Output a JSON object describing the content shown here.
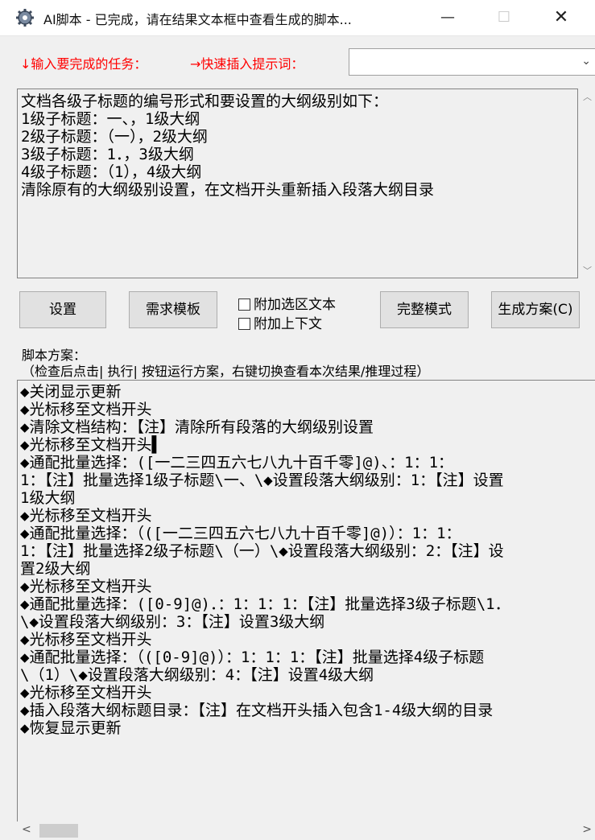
{
  "window": {
    "title": "AI脚本 - 已完成，请在结果文本框中查看生成的脚本...",
    "minimize_glyph": "—",
    "maximize_glyph": "☐",
    "close_glyph": "✕",
    "icon": "gear-icon"
  },
  "task": {
    "label": "↓输入要完成的任务：",
    "quick_insert_label": "→快速插入提示词：",
    "quick_insert_value": "",
    "text": "文档各级子标题的编号形式和要设置的大纲级别如下：\n1级子标题：一、，1级大纲\n2级子标题：（一），2级大纲\n3级子标题：1．，3级大纲\n4级子标题：（1），4级大纲\n清除原有的大纲级别设置，在文档开头重新插入段落大纲目录"
  },
  "toolbar": {
    "settings_label": "设置",
    "template_label": "需求模板",
    "attach_selection_label": "附加选区文本",
    "attach_context_label": "附加上下文",
    "full_mode_label": "完整模式",
    "generate_label": "生成方案(C)"
  },
  "script": {
    "label": "脚本方案：",
    "hint": "（检查后点击| 执行| 按钮运行方案，右键切换查看本次结果/推理过程）",
    "text": "◆关闭显示更新\n◆光标移至文档开头\n◆清除文档结构：【注】清除所有段落的大纲级别设置\n◆光标移至文档开头▌\n◆通配批量选择：([一二三四五六七八九十百千零]@)、：1：1：\n1：【注】批量选择1级子标题\\一、\\◆设置段落大纲级别：1：【注】设置\n1级大纲\n◆光标移至文档开头\n◆通配批量选择：（([一二三四五六七八九十百千零]@)）：1：1：\n1：【注】批量选择2级子标题\\（一）\\◆设置段落大纲级别：2：【注】设\n置2级大纲\n◆光标移至文档开头\n◆通配批量选择：([0-9]@)．：1：1：1：【注】批量选择3级子标题\\1．\n\\◆设置段落大纲级别：3：【注】设置3级大纲\n◆光标移至文档开头\n◆通配批量选择：（([0-9]@)）：1：1：1：【注】批量选择4级子标题\n\\（1）\\◆设置段落大纲级别：4：【注】设置4级大纲\n◆光标移至文档开头\n◆插入段落大纲标题目录：【注】在文档开头插入包含1-4级大纲的目录\n◆恢复显示更新"
  }
}
